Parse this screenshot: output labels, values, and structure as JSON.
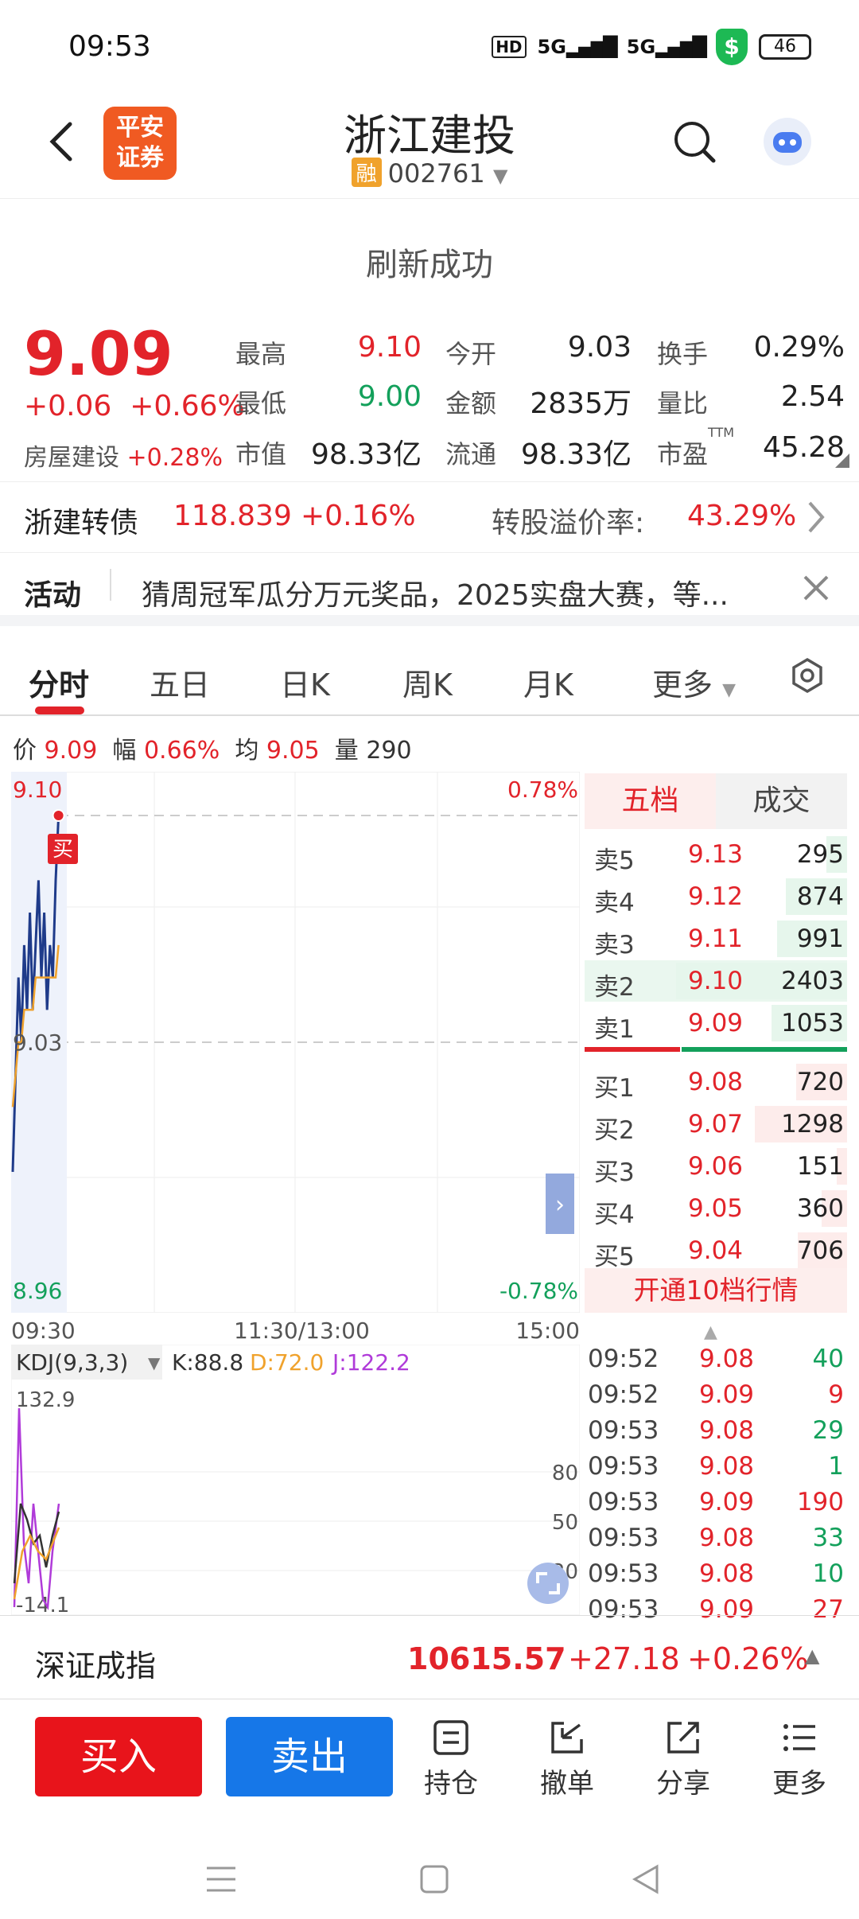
{
  "status": {
    "time": "09:53",
    "hd": "HD",
    "signal1": "5G",
    "signal2": "5G",
    "shield": "$",
    "battery": "46"
  },
  "header": {
    "logo_line1": "平安",
    "logo_line2": "证券",
    "title": "浙江建投",
    "rong": "融",
    "code": "002761"
  },
  "refresh_text": "刷新成功",
  "quote": {
    "price": "9.09",
    "change": "+0.06",
    "change_pct": "+0.66%",
    "sector_name": "房屋建设",
    "sector_pct": "+0.28%",
    "cells": [
      {
        "label": "最高",
        "value": "9.10",
        "color": "red"
      },
      {
        "label": "今开",
        "value": "9.03",
        "color": "dark"
      },
      {
        "label": "换手",
        "value": "0.29%",
        "color": "dark"
      },
      {
        "label": "最低",
        "value": "9.00",
        "color": "green"
      },
      {
        "label": "金额",
        "value": "2835万",
        "color": "dark"
      },
      {
        "label": "量比",
        "value": "2.54",
        "color": "dark"
      },
      {
        "label": "市值",
        "value": "98.33亿",
        "color": "dark"
      },
      {
        "label": "流通",
        "value": "98.33亿",
        "color": "dark"
      },
      {
        "label": "市盈",
        "value": "45.28",
        "color": "dark"
      }
    ],
    "ttm": "TTM"
  },
  "cb": {
    "name": "浙建转债",
    "price": "118.839",
    "pct": "+0.16%",
    "premium_label": "转股溢价率:",
    "premium": "43.29%"
  },
  "activity": {
    "label": "活动",
    "text": "猜周冠军瓜分万元奖品，2025实盘大赛，等..."
  },
  "tabs": [
    "分时",
    "五日",
    "日K",
    "周K",
    "月K",
    "更多"
  ],
  "chart_info": {
    "price_label": "价",
    "price": "9.09",
    "amp_label": "幅",
    "amp": "0.66%",
    "avg_label": "均",
    "avg": "9.05",
    "vol_label": "量",
    "vol": "290"
  },
  "chart_axis": {
    "top": "9.10",
    "top_pct": "0.78%",
    "mid": "9.03",
    "bottom": "8.96",
    "bottom_pct": "-0.78%",
    "t0": "09:30",
    "t1": "11:30/13:00",
    "t2": "15:00",
    "buy_marker": "买"
  },
  "chart_data": {
    "type": "line",
    "series": [
      {
        "values": [
          8.99,
          9.02,
          9.05,
          9.03,
          9.06,
          9.04,
          9.07,
          9.04,
          9.06,
          9.08,
          9.05,
          9.07,
          9.04,
          9.06,
          9.05,
          9.08,
          9.1
        ]
      },
      {
        "values": [
          9.01,
          9.02,
          9.03,
          9.03,
          9.04,
          9.04,
          9.04,
          9.04,
          9.05,
          9.05,
          9.05,
          9.05,
          9.05,
          9.05,
          9.05,
          9.05,
          9.06
        ]
      }
    ],
    "ylim": [
      8.96,
      9.1
    ]
  },
  "kdj": {
    "label": "KDJ(9,3,3)",
    "k": "K:88.8",
    "d": "D:72.0",
    "j": "J:122.2",
    "top": "132.9",
    "bottom": "-14.1",
    "l80": "80",
    "l50": "50",
    "l20": "20"
  },
  "book": {
    "tab1": "五档",
    "tab2": "成交",
    "asks": [
      {
        "label": "卖5",
        "price": "9.13",
        "vol": "295",
        "bar": 0.12
      },
      {
        "label": "卖4",
        "price": "9.12",
        "vol": "874",
        "bar": 0.36
      },
      {
        "label": "卖3",
        "price": "9.11",
        "vol": "991",
        "bar": 0.41
      },
      {
        "label": "卖2",
        "price": "9.10",
        "vol": "2403",
        "bar": 1.0
      },
      {
        "label": "卖1",
        "price": "9.09",
        "vol": "1053",
        "bar": 0.44
      }
    ],
    "bids": [
      {
        "label": "买1",
        "price": "9.08",
        "vol": "720",
        "bar": 0.3
      },
      {
        "label": "买2",
        "price": "9.07",
        "vol": "1298",
        "bar": 0.54
      },
      {
        "label": "买3",
        "price": "9.06",
        "vol": "151",
        "bar": 0.06
      },
      {
        "label": "买4",
        "price": "9.05",
        "vol": "360",
        "bar": 0.15
      },
      {
        "label": "买5",
        "price": "9.04",
        "vol": "706",
        "bar": 0.29
      }
    ],
    "open10": "开通10档行情",
    "trades": [
      {
        "t": "09:52",
        "p": "9.08",
        "v": "40",
        "c": "green"
      },
      {
        "t": "09:52",
        "p": "9.09",
        "v": "9",
        "c": "red"
      },
      {
        "t": "09:53",
        "p": "9.08",
        "v": "29",
        "c": "green"
      },
      {
        "t": "09:53",
        "p": "9.08",
        "v": "1",
        "c": "green"
      },
      {
        "t": "09:53",
        "p": "9.09",
        "v": "190",
        "c": "red"
      },
      {
        "t": "09:53",
        "p": "9.08",
        "v": "33",
        "c": "green"
      },
      {
        "t": "09:53",
        "p": "9.08",
        "v": "10",
        "c": "green"
      },
      {
        "t": "09:53",
        "p": "9.09",
        "v": "27",
        "c": "red"
      }
    ]
  },
  "index": {
    "name": "深证成指",
    "value": "10615.57",
    "change": "+27.18",
    "pct": "+0.26%"
  },
  "actions": {
    "buy": "买入",
    "sell": "卖出",
    "hold": "持仓",
    "cancel": "撤单",
    "share": "分享",
    "more": "更多"
  },
  "colors": {
    "red": "#e2232a",
    "green": "#13a05b",
    "blue": "#1677e8",
    "orange": "#f05a22",
    "line_price": "#1f3b8a",
    "line_avg": "#f0a22c"
  }
}
